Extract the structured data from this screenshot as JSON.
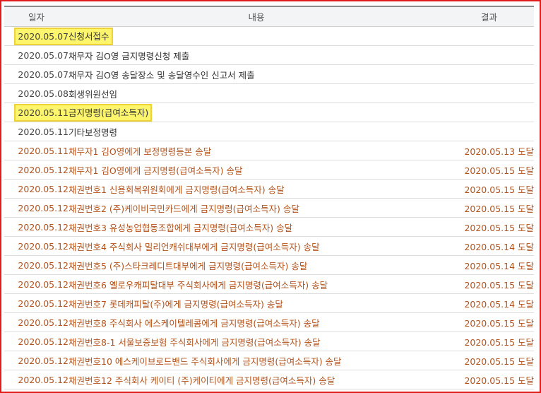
{
  "header": {
    "date": "일자",
    "content": "내용",
    "result": "결과"
  },
  "rows": [
    {
      "date": "2020.05.07",
      "content": "신청서접수",
      "result": "",
      "style": "normal",
      "highlight": true
    },
    {
      "date": "2020.05.07",
      "content": "채무자 김O영 금지명령신청 제출",
      "result": "",
      "style": "normal",
      "highlight": false
    },
    {
      "date": "2020.05.07",
      "content": "채무자 김O영 송달장소 및 송달영수인 신고서 제출",
      "result": "",
      "style": "normal",
      "highlight": false
    },
    {
      "date": "2020.05.08",
      "content": "회생위원선임",
      "result": "",
      "style": "normal",
      "highlight": false
    },
    {
      "date": "2020.05.11",
      "content": "금지명령(급여소득자)",
      "result": "",
      "style": "normal",
      "highlight": true
    },
    {
      "date": "2020.05.11",
      "content": "기타보정명령",
      "result": "",
      "style": "normal",
      "highlight": false
    },
    {
      "date": "2020.05.11",
      "content": "채무자1 김O영에게 보정명령등본 송달",
      "result": "2020.05.13 도달",
      "style": "orange",
      "highlight": false
    },
    {
      "date": "2020.05.12",
      "content": "채무자1 김O영에게 금지명령(급여소득자) 송달",
      "result": "2020.05.15 도달",
      "style": "orange",
      "highlight": false
    },
    {
      "date": "2020.05.12",
      "content": "채권번호1 신용회복위원회에게 금지명령(급여소득자) 송달",
      "result": "2020.05.15 도달",
      "style": "orange",
      "highlight": false
    },
    {
      "date": "2020.05.12",
      "content": "채권번호2 (주)케이비국민카드에게 금지명령(급여소득자) 송달",
      "result": "2020.05.15 도달",
      "style": "orange",
      "highlight": false
    },
    {
      "date": "2020.05.12",
      "content": "채권번호3 유성농업협동조합에게 금지명령(급여소득자) 송달",
      "result": "2020.05.15 도달",
      "style": "orange",
      "highlight": false
    },
    {
      "date": "2020.05.12",
      "content": "채권번호4 주식회사 밀리언캐쉬대부에게 금지명령(급여소득자) 송달",
      "result": "2020.05.14 도달",
      "style": "orange",
      "highlight": false
    },
    {
      "date": "2020.05.12",
      "content": "채권번호5 (주)스타크레디트대부에게 금지명령(급여소득자) 송달",
      "result": "2020.05.14 도달",
      "style": "orange",
      "highlight": false
    },
    {
      "date": "2020.05.12",
      "content": "채권번호6 옐로우캐피탈대부 주식회사에게 금지명령(급여소득자) 송달",
      "result": "2020.05.15 도달",
      "style": "orange",
      "highlight": false
    },
    {
      "date": "2020.05.12",
      "content": "채권번호7 롯데캐피탈(주)에게 금지명령(급여소득자) 송달",
      "result": "2020.05.14 도달",
      "style": "orange",
      "highlight": false
    },
    {
      "date": "2020.05.12",
      "content": "채권번호8 주식회사 에스케이텔레콤에게 금지명령(급여소득자) 송달",
      "result": "2020.05.15 도달",
      "style": "orange",
      "highlight": false
    },
    {
      "date": "2020.05.12",
      "content": "채권번호8-1 서울보증보험 주식회사에게 금지명령(급여소득자) 송달",
      "result": "2020.05.15 도달",
      "style": "orange",
      "highlight": false
    },
    {
      "date": "2020.05.12",
      "content": "채권번호10 에스케이브로드밴드 주식회사에게 금지명령(급여소득자) 송달",
      "result": "2020.05.15 도달",
      "style": "orange",
      "highlight": false
    },
    {
      "date": "2020.05.12",
      "content": "채권번호12 주식회사 케이티 (주)케이티에게 금지명령(급여소득자) 송달",
      "result": "2020.05.15 도달",
      "style": "orange",
      "highlight": false
    }
  ],
  "colors": {
    "frame_border": "#e01c1c",
    "highlight_fill": "#fdf56c",
    "highlight_border": "#efd235",
    "orange_text": "#b3521b",
    "normal_text": "#333333",
    "header_bg": "#f3f4f6"
  }
}
